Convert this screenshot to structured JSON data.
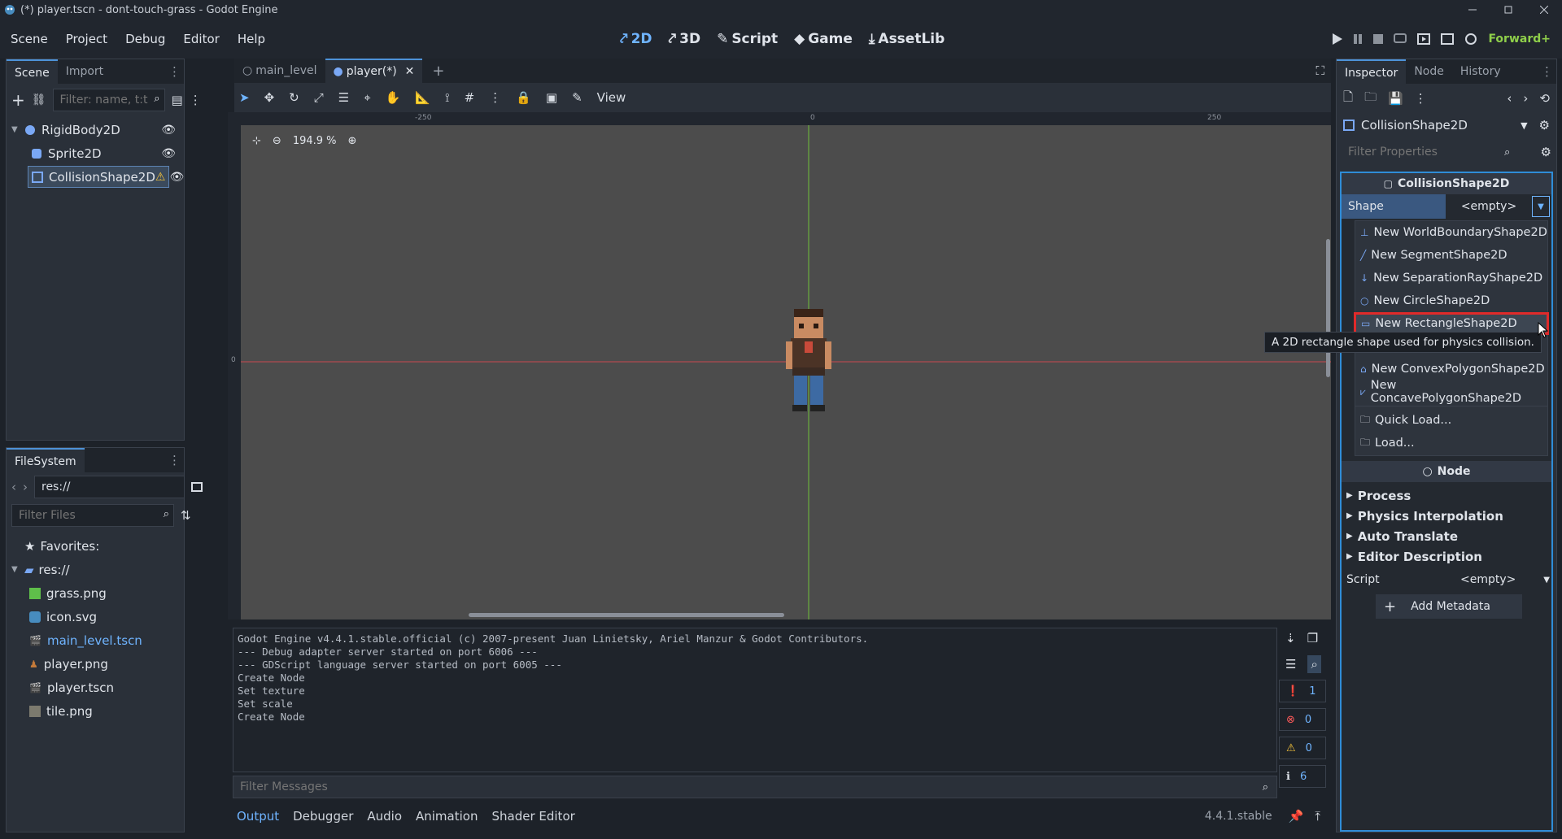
{
  "window": {
    "title": "(*) player.tscn - dont-touch-grass - Godot Engine"
  },
  "menu": [
    "Scene",
    "Project",
    "Debug",
    "Editor",
    "Help"
  ],
  "workspaces": {
    "w2d": "2D",
    "w3d": "3D",
    "script": "Script",
    "game": "Game",
    "assetlib": "AssetLib"
  },
  "renderer": "Forward+",
  "scene_dock": {
    "tab_scene": "Scene",
    "tab_import": "Import",
    "filter_placeholder": "Filter: name, t:t",
    "nodes": [
      {
        "label": "RigidBody2D"
      },
      {
        "label": "Sprite2D"
      },
      {
        "label": "CollisionShape2D"
      }
    ]
  },
  "filesystem": {
    "tab": "FileSystem",
    "path": "res://",
    "filter_placeholder": "Filter Files",
    "favorites": "Favorites:",
    "root": "res://",
    "files": [
      {
        "label": "grass.png"
      },
      {
        "label": "icon.svg"
      },
      {
        "label": "main_level.tscn"
      },
      {
        "label": "player.png"
      },
      {
        "label": "player.tscn"
      },
      {
        "label": "tile.png"
      }
    ]
  },
  "editor_tabs": [
    {
      "label": "main_level"
    },
    {
      "label": "player(*)"
    }
  ],
  "toolbar": {
    "view": "View"
  },
  "viewport": {
    "zoom": "194.9 %",
    "ruler": [
      "-250",
      "0",
      "250"
    ],
    "ruler_v": "0"
  },
  "console": {
    "lines": [
      "Godot Engine v4.4.1.stable.official (c) 2007-present Juan Linietsky, Ariel Manzur & Godot Contributors.",
      "--- Debug adapter server started on port 6006 ---",
      "--- GDScript language server started on port 6005 ---",
      "Create Node",
      "Set texture",
      "Set scale",
      "Create Node"
    ],
    "filter_placeholder": "Filter Messages",
    "counts": {
      "messages": "1",
      "errors": "0",
      "warnings": "0",
      "info": "6"
    }
  },
  "bottom_tabs": [
    "Output",
    "Debugger",
    "Audio",
    "Animation",
    "Shader Editor"
  ],
  "version": "4.4.1.stable",
  "inspector": {
    "tabs": [
      "Inspector",
      "Node",
      "History"
    ],
    "object": "CollisionShape2D",
    "filter_placeholder": "Filter Properties",
    "section": "CollisionShape2D",
    "shape_label": "Shape",
    "shape_value": "<empty>",
    "dropdown": [
      "New WorldBoundaryShape2D",
      "New SegmentShape2D",
      "New SeparationRayShape2D",
      "New CircleShape2D",
      "New RectangleShape2D",
      "New ConvexPolygonShape2D",
      "New ConcavePolygonShape2D"
    ],
    "quick_load": "Quick Load...",
    "load": "Load...",
    "tooltip": "A 2D rectangle shape used for physics collision.",
    "node_section": "Node",
    "groups": [
      "Process",
      "Physics Interpolation",
      "Auto Translate",
      "Editor Description"
    ],
    "script_label": "Script",
    "script_value": "<empty>",
    "add_metadata": "Add Metadata"
  },
  "colors": {
    "accent": "#6fb4ff",
    "highlight": "#e02a2a",
    "bg": "#1d2229",
    "panel": "#2a3039"
  }
}
